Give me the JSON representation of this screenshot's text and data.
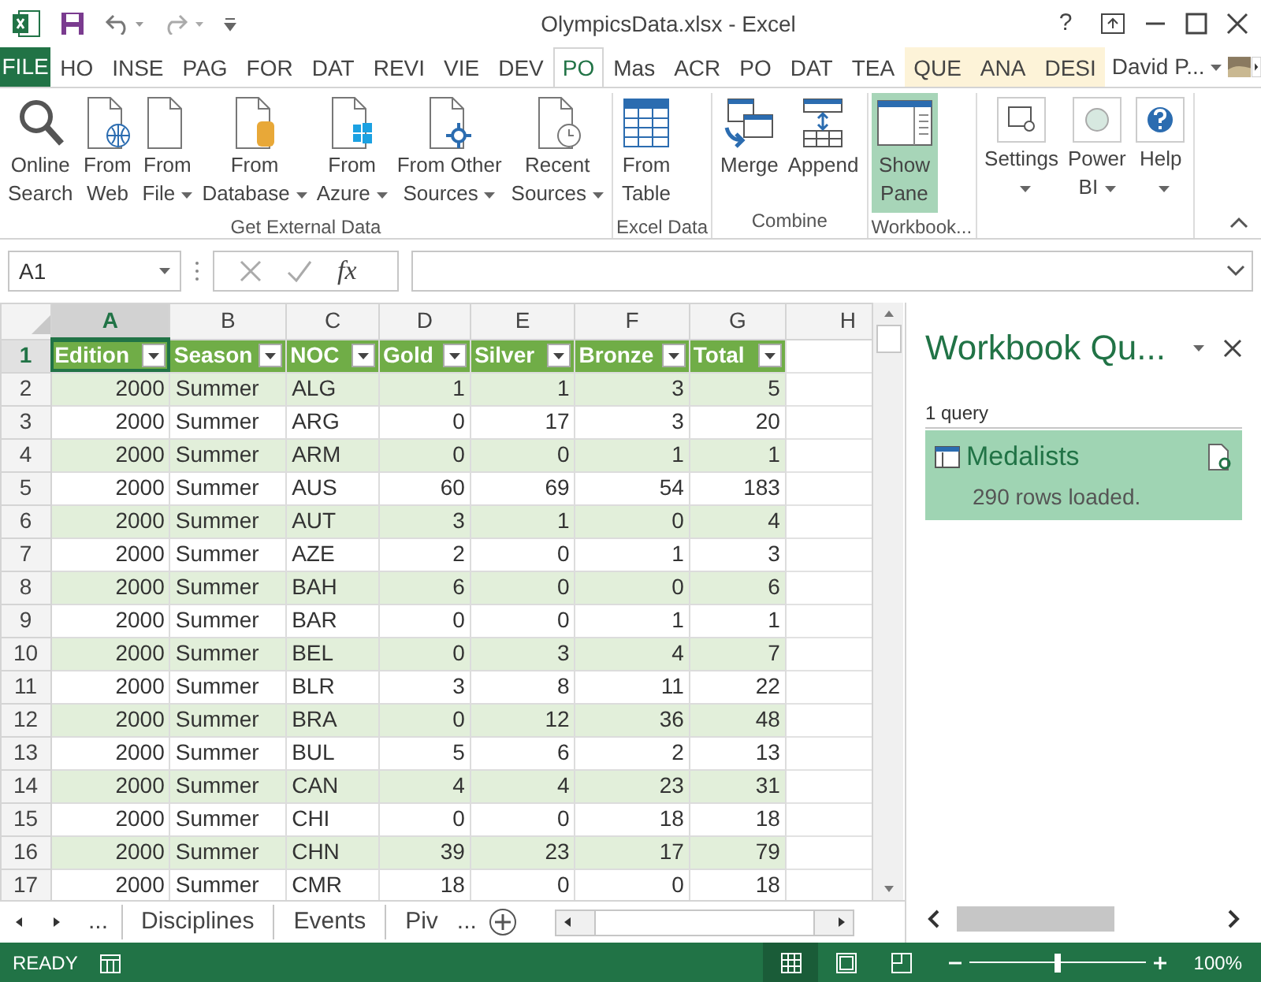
{
  "window": {
    "title": "OlympicsData.xlsx - Excel",
    "help": "?"
  },
  "file_tab": "FILE",
  "ribbon_tabs": [
    {
      "label": "HO",
      "selected": false,
      "contextual": false
    },
    {
      "label": "INSE",
      "selected": false,
      "contextual": false
    },
    {
      "label": "PAG",
      "selected": false,
      "contextual": false
    },
    {
      "label": "FOR",
      "selected": false,
      "contextual": false
    },
    {
      "label": "DAT",
      "selected": false,
      "contextual": false
    },
    {
      "label": "REVI",
      "selected": false,
      "contextual": false
    },
    {
      "label": "VIE",
      "selected": false,
      "contextual": false
    },
    {
      "label": "DEV",
      "selected": false,
      "contextual": false
    },
    {
      "label": "PO",
      "selected": true,
      "contextual": false
    },
    {
      "label": "Mas",
      "selected": false,
      "contextual": false
    },
    {
      "label": "ACR",
      "selected": false,
      "contextual": false
    },
    {
      "label": "PO",
      "selected": false,
      "contextual": false
    },
    {
      "label": "DAT",
      "selected": false,
      "contextual": false
    },
    {
      "label": "TEA",
      "selected": false,
      "contextual": false
    },
    {
      "label": "QUE",
      "selected": false,
      "contextual": true
    },
    {
      "label": "ANA",
      "selected": false,
      "contextual": true
    },
    {
      "label": "DESI",
      "selected": false,
      "contextual": true
    }
  ],
  "user": "David P...",
  "ribbon_groups": [
    {
      "label": "Get External Data",
      "buttons": [
        {
          "lines": [
            "Online",
            "Search"
          ],
          "dropdown": false,
          "selected": false
        },
        {
          "lines": [
            "From",
            "Web"
          ],
          "dropdown": false,
          "selected": false
        },
        {
          "lines": [
            "From",
            "File"
          ],
          "dropdown": true,
          "selected": false
        },
        {
          "lines": [
            "From",
            "Database"
          ],
          "dropdown": true,
          "selected": false
        },
        {
          "lines": [
            "From",
            "Azure"
          ],
          "dropdown": true,
          "selected": false
        },
        {
          "lines": [
            "From Other",
            "Sources"
          ],
          "dropdown": true,
          "selected": false
        },
        {
          "lines": [
            "Recent",
            "Sources"
          ],
          "dropdown": true,
          "selected": false
        }
      ]
    },
    {
      "label": "Excel Data",
      "buttons": [
        {
          "lines": [
            "From",
            "Table"
          ],
          "dropdown": false,
          "selected": false
        }
      ]
    },
    {
      "label": "Combine",
      "buttons": [
        {
          "lines": [
            "Merge"
          ],
          "dropdown": false,
          "selected": false
        },
        {
          "lines": [
            "Append"
          ],
          "dropdown": false,
          "selected": false
        }
      ]
    },
    {
      "label": "Workbook...",
      "buttons": [
        {
          "lines": [
            "Show",
            "Pane"
          ],
          "dropdown": false,
          "selected": true
        }
      ]
    },
    {
      "buttons": [
        {
          "lines": [
            "Settings"
          ],
          "dropdown": true,
          "selected": false
        },
        {
          "lines": [
            "Power",
            "BI"
          ],
          "dropdown": true,
          "selected": false
        },
        {
          "lines": [
            "Help"
          ],
          "dropdown": true,
          "selected": false
        }
      ]
    }
  ],
  "name_box": "A1",
  "formula_label": "fx",
  "column_letters": [
    {
      "label": "A",
      "selected": true
    },
    {
      "label": "B",
      "selected": false
    },
    {
      "label": "C",
      "selected": false
    },
    {
      "label": "D",
      "selected": false
    },
    {
      "label": "E",
      "selected": false
    },
    {
      "label": "F",
      "selected": false
    },
    {
      "label": "G",
      "selected": false
    },
    {
      "label": "H",
      "selected": false
    }
  ],
  "table": {
    "columns": [
      "Edition",
      "Season",
      "NOC",
      "Gold",
      "Silver",
      "Bronze",
      "Total"
    ],
    "rows": [
      [
        "2000",
        "Summer",
        "ALG",
        "1",
        "1",
        "3",
        "5"
      ],
      [
        "2000",
        "Summer",
        "ARG",
        "0",
        "17",
        "3",
        "20"
      ],
      [
        "2000",
        "Summer",
        "ARM",
        "0",
        "0",
        "1",
        "1"
      ],
      [
        "2000",
        "Summer",
        "AUS",
        "60",
        "69",
        "54",
        "183"
      ],
      [
        "2000",
        "Summer",
        "AUT",
        "3",
        "1",
        "0",
        "4"
      ],
      [
        "2000",
        "Summer",
        "AZE",
        "2",
        "0",
        "1",
        "3"
      ],
      [
        "2000",
        "Summer",
        "BAH",
        "6",
        "0",
        "0",
        "6"
      ],
      [
        "2000",
        "Summer",
        "BAR",
        "0",
        "0",
        "1",
        "1"
      ],
      [
        "2000",
        "Summer",
        "BEL",
        "0",
        "3",
        "4",
        "7"
      ],
      [
        "2000",
        "Summer",
        "BLR",
        "3",
        "8",
        "11",
        "22"
      ],
      [
        "2000",
        "Summer",
        "BRA",
        "0",
        "12",
        "36",
        "48"
      ],
      [
        "2000",
        "Summer",
        "BUL",
        "5",
        "6",
        "2",
        "13"
      ],
      [
        "2000",
        "Summer",
        "CAN",
        "4",
        "4",
        "23",
        "31"
      ],
      [
        "2000",
        "Summer",
        "CHI",
        "0",
        "0",
        "18",
        "18"
      ],
      [
        "2000",
        "Summer",
        "CHN",
        "39",
        "23",
        "17",
        "79"
      ],
      [
        "2000",
        "Summer",
        "CMR",
        "18",
        "0",
        "0",
        "18"
      ]
    ]
  },
  "row_numbers": [
    "1",
    "2",
    "3",
    "4",
    "5",
    "6",
    "7",
    "8",
    "9",
    "10",
    "11",
    "12",
    "13",
    "14",
    "15",
    "16",
    "17"
  ],
  "sheet_nav_more": "...",
  "sheet_tabs": [
    "Disciplines",
    "Events",
    "Piv"
  ],
  "sheet_tabs_more": "...",
  "pane": {
    "title": "Workbook Qu...",
    "count": "1 query",
    "queries": [
      {
        "name": "Medalists",
        "status": "290 rows loaded.",
        "selected": true
      }
    ]
  },
  "status_bar": {
    "mode": "READY",
    "views": [
      {
        "selected": true
      },
      {
        "selected": false
      },
      {
        "selected": false
      }
    ],
    "zoom": "100%",
    "zoom_slider": {
      "level": 0.5
    }
  }
}
